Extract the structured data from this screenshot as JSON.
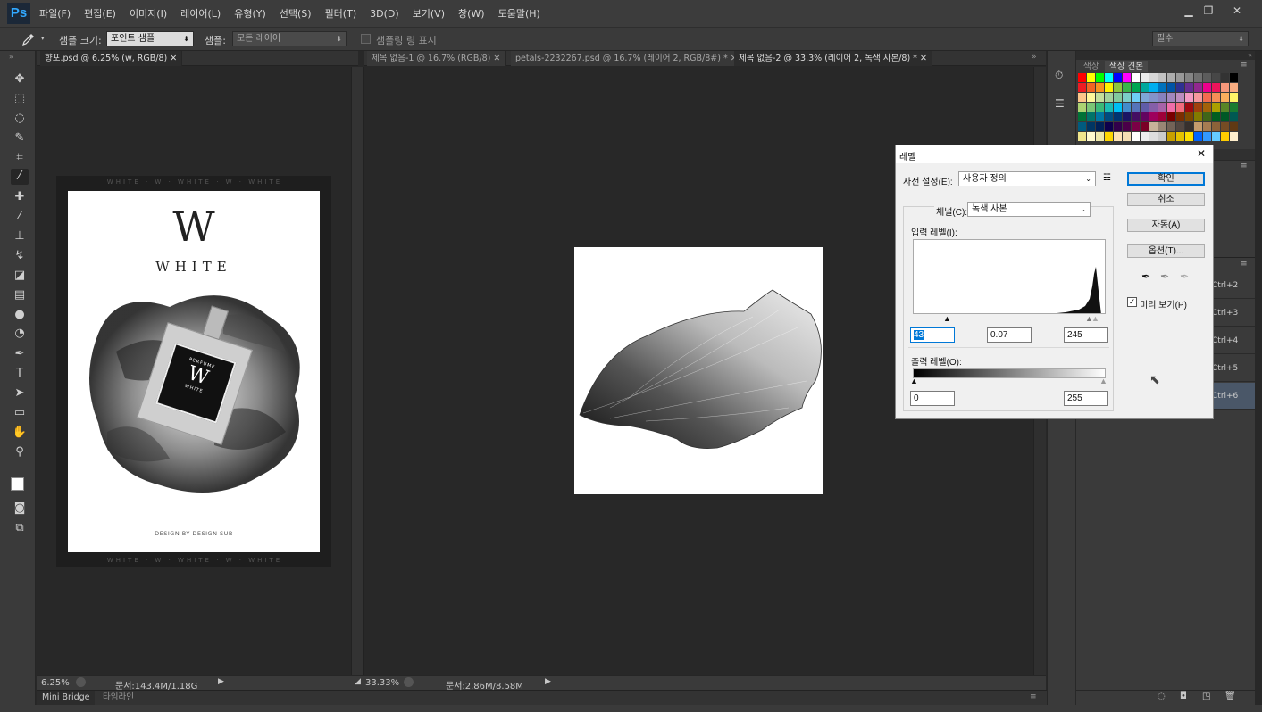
{
  "app": {
    "logo": "Ps"
  },
  "menu": [
    "파일(F)",
    "편집(E)",
    "이미지(I)",
    "레이어(L)",
    "유형(Y)",
    "선택(S)",
    "필터(T)",
    "3D(D)",
    "보기(V)",
    "창(W)",
    "도움말(H)"
  ],
  "window_controls": {
    "minimize": "▁",
    "restore": "❐",
    "close": "✕"
  },
  "options": {
    "sample_size_label": "샘플 크기:",
    "sample_size_value": "포인트 샘플",
    "sample_label": "샘플:",
    "sample_value": "모든 레이어",
    "show_ring_label": "샘플링 링 표시",
    "workspace": "필수"
  },
  "left_doc": {
    "tab": "향포.psd @ 6.25% (w, RGB/8)",
    "zoom": "6.25%",
    "doc_info": "문서:143.4M/1.18G",
    "poster": {
      "logo_letter": "W",
      "brand": "WHITE",
      "label_top": "PERFUME",
      "label_letter": "W",
      "label_bottom": "WHITE",
      "footer": "DESIGN BY DESIGN SUB",
      "border_text": "WHITE · W · WHITE · W · WHITE"
    }
  },
  "center_doc": {
    "tabs": [
      "제목 없음-1 @ 16.7% (RGB/8)",
      "petals-2232267.psd @ 16.7% (레이어 2, RGB/8#) *",
      "제목 없음-2 @ 33.3% (레이어 2, 녹색 사본/8) *"
    ],
    "active_tab": 2,
    "zoom": "33.33%",
    "doc_info": "문서:2.86M/8.58M"
  },
  "bottom_tabs": [
    "Mini Bridge",
    "타임라인"
  ],
  "swatches": {
    "tabs": [
      "색상",
      "색상 견본"
    ],
    "colors": [
      "#ff0000",
      "#ffff00",
      "#00ff00",
      "#00ffff",
      "#0000ff",
      "#ff00ff",
      "#ffffff",
      "#ebebeb",
      "#d6d6d6",
      "#c2c2c2",
      "#adadad",
      "#999999",
      "#858585",
      "#707070",
      "#5c5c5c",
      "#474747",
      "#333333",
      "#000000",
      "#ed1c24",
      "#f26522",
      "#f7941d",
      "#fff200",
      "#8dc63f",
      "#39b54a",
      "#00a651",
      "#00a99d",
      "#00aeef",
      "#0072bc",
      "#0054a6",
      "#2e3192",
      "#662d91",
      "#92278f",
      "#ec008c",
      "#ed145b",
      "#f7977a",
      "#f9ad81",
      "#fdc68a",
      "#fff79a",
      "#c4df9b",
      "#a3d39c",
      "#82ca9d",
      "#7bcdc8",
      "#6ecff6",
      "#7ea7d8",
      "#8393ca",
      "#8781bd",
      "#a187be",
      "#bc8dbf",
      "#f49ac2",
      "#f6989d",
      "#f26c4f",
      "#f68e56",
      "#fbaf5d",
      "#fff467",
      "#acd372",
      "#7cc576",
      "#3bb878",
      "#1abbb4",
      "#00bff3",
      "#438ccb",
      "#5574b9",
      "#605ca8",
      "#855fa8",
      "#a763a8",
      "#f06ea9",
      "#f26d7d",
      "#9e0b0f",
      "#a0410d",
      "#a36209",
      "#aba000",
      "#598527",
      "#1a7b30",
      "#007236",
      "#00746b",
      "#0076a3",
      "#004b80",
      "#003471",
      "#1b1464",
      "#440e62",
      "#630460",
      "#9e005d",
      "#9e0039",
      "#790000",
      "#7b2e00",
      "#7d4900",
      "#827b00",
      "#406618",
      "#005e20",
      "#005826",
      "#005952",
      "#005b7f",
      "#003663",
      "#002157",
      "#0d004c",
      "#32004b",
      "#4b0049",
      "#7b0046",
      "#7a0026",
      "#c7b299",
      "#998675",
      "#736357",
      "#534741",
      "#37302d",
      "#c69c6d",
      "#a67c52",
      "#8c6239",
      "#754c24",
      "#603913",
      "#f0e68c",
      "#fffacd",
      "#eee8aa",
      "#ffd700",
      "#ffe4b5",
      "#f5deb3",
      "#ffffff",
      "#eeeeee",
      "#dddddd",
      "#cccccc",
      "#c8a000",
      "#e6c200",
      "#ffe000",
      "#0066ff",
      "#3399ff",
      "#66ccff",
      "#ffcc00",
      "#ffeecc"
    ]
  },
  "layer_shortcuts": [
    "Ctrl+2",
    "Ctrl+3",
    "Ctrl+4",
    "Ctrl+5",
    "Ctrl+6"
  ],
  "levels_dialog": {
    "title": "레벨",
    "preset_label": "사전 설정(E):",
    "preset_value": "사용자 정의",
    "channel_label": "채널(C):",
    "channel_value": "녹색 사본",
    "input_label": "입력 레벨(I):",
    "input_black": "43",
    "input_gamma": "0.07",
    "input_white": "245",
    "output_label": "출력 레벨(O):",
    "output_black": "0",
    "output_white": "255",
    "ok": "확인",
    "cancel": "취소",
    "auto": "자동(A)",
    "options": "옵션(T)...",
    "preview": "미리 보기(P)",
    "preview_checked": true
  }
}
